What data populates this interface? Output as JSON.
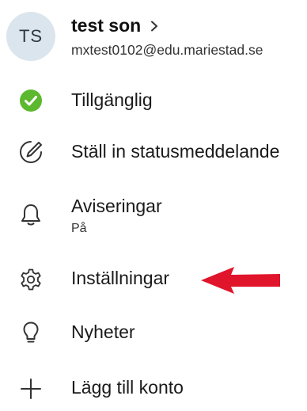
{
  "profile": {
    "initials": "TS",
    "name": "test son",
    "email": "mxtest0102@edu.mariestad.se"
  },
  "menu": {
    "available": {
      "label": "Tillgänglig",
      "icon": "check-circle-icon",
      "color": "#5cb82e"
    },
    "status_message": {
      "label": "Ställ in statusmeddelande",
      "icon": "edit-status-icon"
    },
    "notifications": {
      "label": "Aviseringar",
      "sublabel": "På",
      "icon": "bell-icon"
    },
    "settings": {
      "label": "Inställningar",
      "icon": "gear-icon"
    },
    "whats_new": {
      "label": "Nyheter",
      "icon": "lightbulb-icon"
    },
    "add_account": {
      "label": "Lägg till konto",
      "icon": "plus-icon"
    }
  },
  "annotation": {
    "icon": "red-arrow-icon",
    "color": "#e0142a"
  }
}
